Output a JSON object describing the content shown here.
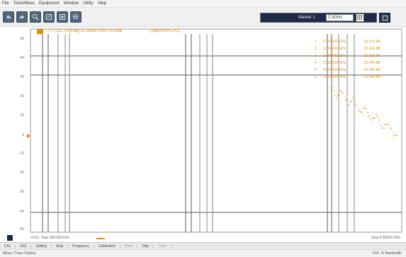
{
  "menubar": {
    "items": [
      "File",
      "Tests/Meas",
      "Equipment",
      "Window",
      "Utility",
      "Help"
    ]
  },
  "toolbar": {
    "buttons": [
      "undo-icon",
      "redo-icon",
      "zoom-in-icon",
      "zoom-out-icon",
      "zoom-fit-icon",
      "marker-search-icon"
    ],
    "marker_label": "Marker 1",
    "marker_value": "2.3GHz"
  },
  "trace": {
    "title": "Tr 1 S11 LogMag 10.00dB/ Ref 0.000dB",
    "tag": "[Spectrum Ch1]"
  },
  "y_axis": {
    "ticks": [
      "50",
      "40",
      "30",
      "20",
      "10",
      "0",
      "-10",
      "-20",
      "-30",
      "-40",
      "-50"
    ]
  },
  "markers": [
    {
      "id": "1",
      "freq": "1.000000 GHz",
      "value": "-33.572 dB"
    },
    {
      "id": "2",
      "freq": "1.500000 GHz",
      "value": "-33.194 dB"
    },
    {
      "id": "3",
      "freq": "2.000000 GHz",
      "value": "-32.818 dB"
    },
    {
      "id": "4",
      "freq": "2.500000 GHz",
      "value": "-32.441 dB"
    },
    {
      "id": "5",
      "freq": "3.000000 GHz",
      "value": "-32.066 dB"
    },
    {
      "id": "6",
      "freq": "3.500000 GHz",
      "value": "-31.689 dB"
    }
  ],
  "x_axis": {
    "start": ">Ch1: Start 300.000 kHz",
    "stop": "Stop 8.50000 GHz"
  },
  "bottom_tabs": {
    "items": [
      "Ch1",
      "Ch2",
      "Setting",
      "Stop",
      "Frequency",
      "Calibration",
      "Point",
      "Disp",
      "Trace"
    ]
  },
  "statusbar": {
    "left": "Meas | Trace Display",
    "right": "Ch1: IF Bandwidth"
  },
  "colors": {
    "trace": "#e08f10",
    "toolbar_button": "#51667a",
    "marker_box": "#1e2a44"
  }
}
